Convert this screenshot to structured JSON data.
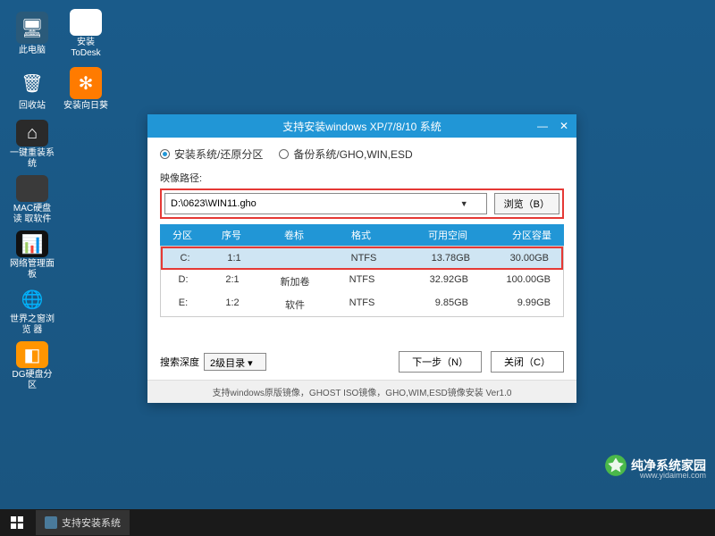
{
  "desktop_icons": [
    [
      {
        "name": "this-pc",
        "label": "此电脑",
        "bg": "#2a5a7a",
        "glyph": "🖥"
      },
      {
        "name": "todesk",
        "label": "安装ToDesk",
        "bg": "#ffffff",
        "glyph": ""
      }
    ],
    [
      {
        "name": "recycle-bin",
        "label": "回收站",
        "bg": "transparent",
        "glyph": "🗑"
      },
      {
        "name": "sunflower",
        "label": "安装向日葵",
        "bg": "#ff7b00",
        "glyph": "✻"
      }
    ],
    [
      {
        "name": "onekey-install",
        "label": "一键重装系统",
        "bg": "#2a2a2a",
        "glyph": "⌂"
      }
    ],
    [
      {
        "name": "mac-disk",
        "label": "MAC硬盘读\n取软件",
        "bg": "#3a3a3a",
        "glyph": ""
      }
    ],
    [
      {
        "name": "network-panel",
        "label": "网络管理面板",
        "bg": "#111",
        "glyph": "📊"
      }
    ],
    [
      {
        "name": "world-browser",
        "label": "世界之窗浏览\n器",
        "bg": "transparent",
        "glyph": "🌐"
      }
    ],
    [
      {
        "name": "dg-partition",
        "label": "DG硬盘分区",
        "bg": "#ff9500",
        "glyph": "◧"
      }
    ]
  ],
  "dialog": {
    "title": "支持安装windows XP/7/8/10 系统",
    "tabs": {
      "install": "安装系统/还原分区",
      "backup": "备份系统/GHO,WIN,ESD"
    },
    "path_label": "映像路径:",
    "path_value": "D:\\0623\\WIN11.gho",
    "browse": "浏览（B）",
    "table_headers": {
      "drive": "分区",
      "num": "序号",
      "label": "卷标",
      "fmt": "格式",
      "free": "可用空间",
      "size": "分区容量"
    },
    "drives": [
      {
        "drive": "C:",
        "num": "1:1",
        "label": "",
        "fmt": "NTFS",
        "free": "13.78GB",
        "size": "30.00GB",
        "selected": true
      },
      {
        "drive": "D:",
        "num": "2:1",
        "label": "新加卷",
        "fmt": "NTFS",
        "free": "32.92GB",
        "size": "100.00GB",
        "selected": false
      },
      {
        "drive": "E:",
        "num": "1:2",
        "label": "软件",
        "fmt": "NTFS",
        "free": "9.85GB",
        "size": "9.99GB",
        "selected": false
      }
    ],
    "depth_label": "搜索深度",
    "depth_value": "2级目录",
    "next_btn": "下一步（N）",
    "close_btn": "关闭（C）",
    "footer": "支持windows原版镜像，GHOST ISO镜像，GHO,WIM,ESD镜像安装 Ver1.0"
  },
  "taskbar": {
    "task_label": "支持安装系统"
  },
  "watermark": {
    "text": "纯净系统家园",
    "url": "www.yidaimei.com"
  }
}
